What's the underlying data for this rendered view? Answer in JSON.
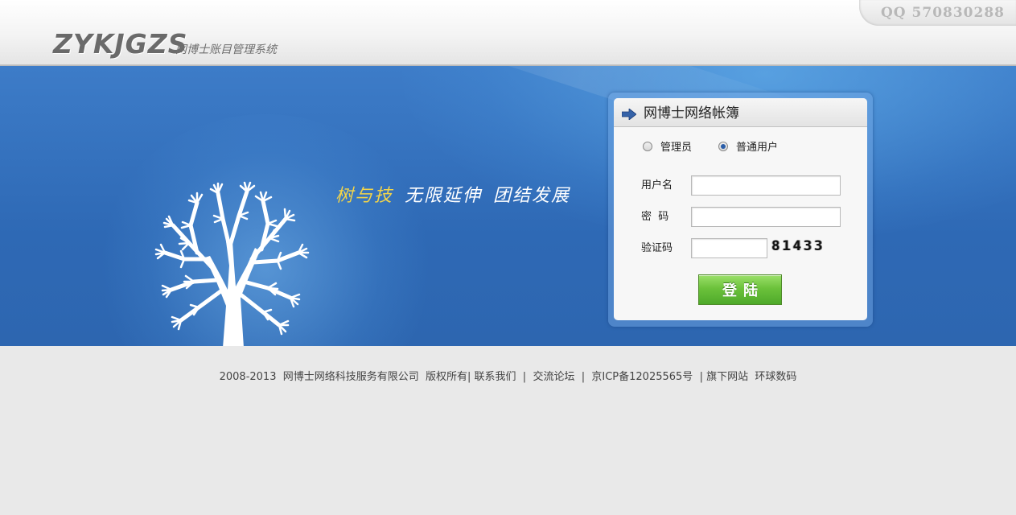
{
  "header": {
    "logo_text": "ZYKJGZS",
    "logo_subtitle": "网博士账目管理系统",
    "qq_text": "QQ  570830288"
  },
  "banner": {
    "slogan_1": "树与技",
    "slogan_2": "无限延伸",
    "slogan_3": "团结发展"
  },
  "login": {
    "title": "网博士网络帐簿",
    "roles": [
      {
        "label": "管理员",
        "selected": false
      },
      {
        "label": "普通用户",
        "selected": true
      }
    ],
    "username_label": "用户名",
    "username_value": "",
    "password_label": "密  码",
    "password_value": "",
    "captcha_label": "验证码",
    "captcha_value": "",
    "captcha_code": "81433",
    "submit_label": "登陆"
  },
  "footer": {
    "copyright": "2008-2013  网博士网络科技服务有限公司  版权所有| ",
    "contact": "联系我们",
    "sep1": "  |  ",
    "forum": "交流论坛",
    "sep2": "  |  ",
    "icp": "京ICP备12025565号",
    "sep3": "  | ",
    "sites": "旗下网站",
    "sep4": "  ",
    "global": "环球数码"
  },
  "colors": {
    "banner_blue": "#2e69b5",
    "button_green": "#6cc23b",
    "slogan_yellow": "#f2d44a"
  }
}
